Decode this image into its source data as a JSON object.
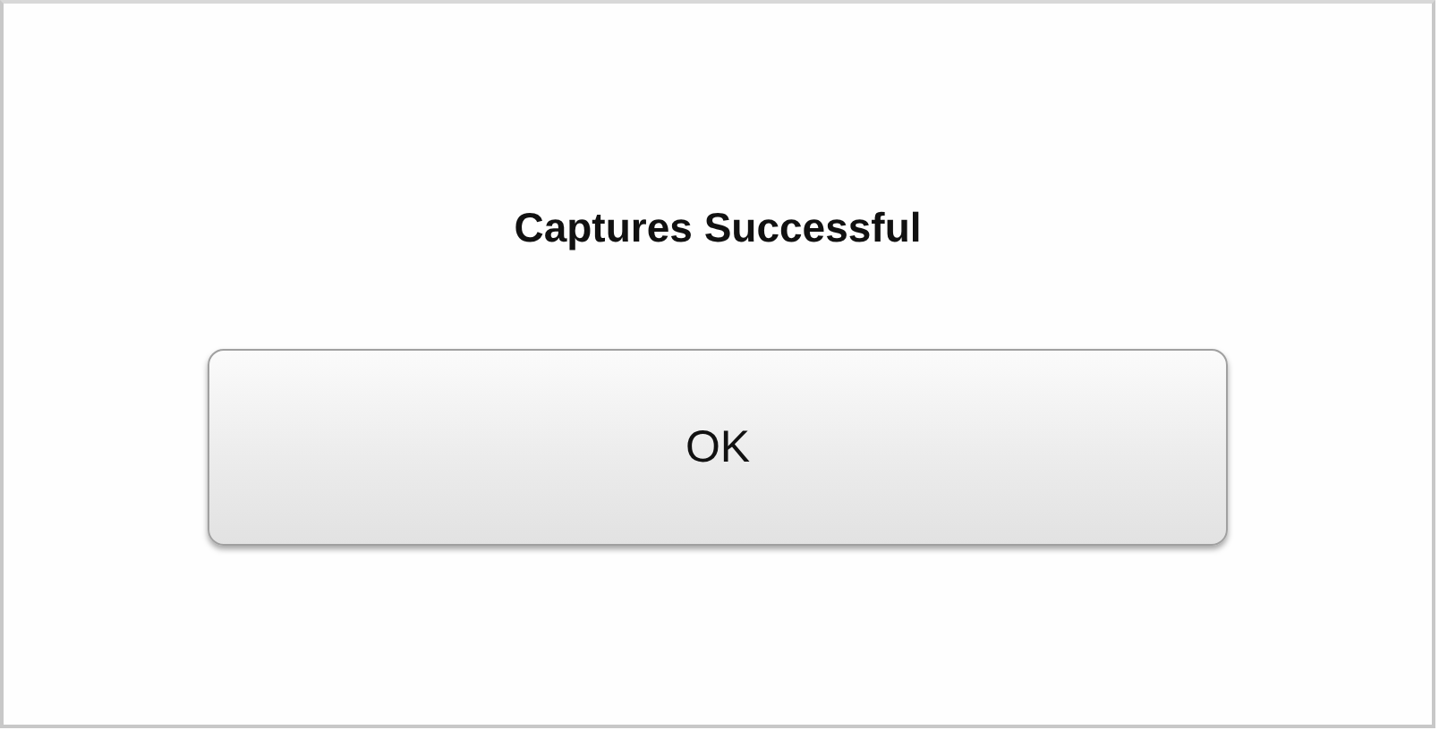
{
  "dialog": {
    "message": "Captures Successful",
    "buttons": [
      {
        "label": "OK"
      }
    ]
  }
}
